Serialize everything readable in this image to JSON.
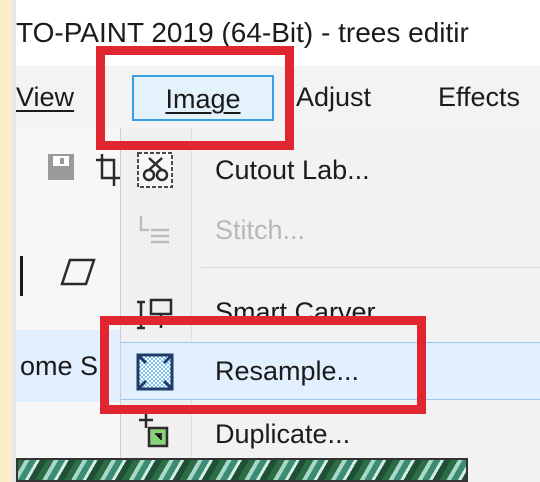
{
  "window": {
    "title": "TO-PAINT 2019 (64-Bit) - trees editir"
  },
  "menubar": {
    "items": [
      {
        "label": "View",
        "mnemonic_index": 0
      },
      {
        "label": "Image",
        "mnemonic_index": 0
      },
      {
        "label": "Adjust",
        "mnemonic_index": 0
      },
      {
        "label": "Effects",
        "mnemonic_index": 4
      }
    ]
  },
  "image_menu": {
    "items": [
      {
        "label": "Cutout Lab...",
        "icon": "cutout-lab-icon",
        "enabled": true
      },
      {
        "label": "Stitch...",
        "icon": "stitch-icon",
        "enabled": false
      },
      {
        "label": "Smart Carver...",
        "icon": "smart-carver-icon",
        "enabled": true
      },
      {
        "label": "Resample...",
        "icon": "resample-icon",
        "enabled": true,
        "highlighted": true
      },
      {
        "label": "Duplicate...",
        "icon": "duplicate-icon",
        "enabled": true
      }
    ]
  },
  "leftpane": {
    "row_text": "ome S"
  },
  "colors": {
    "background": "#fdecc8",
    "highlight_box": "#e0262f",
    "menu_selected_border": "#38a0e2",
    "menu_selected_fill": "#e4f2fb",
    "row_highlight": "#e1efff"
  }
}
